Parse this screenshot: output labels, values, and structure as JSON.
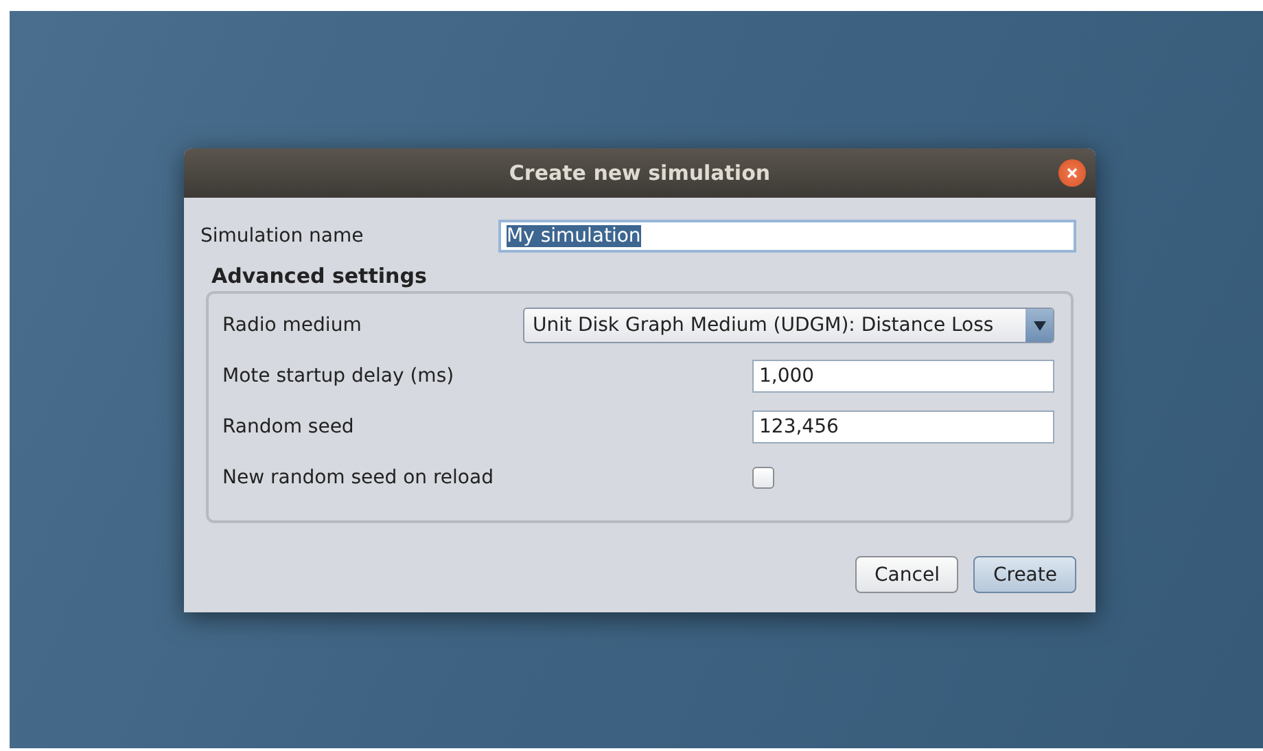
{
  "window": {
    "title": "Create new simulation"
  },
  "name_field": {
    "label": "Simulation name",
    "value": "My simulation",
    "selected": true
  },
  "advanced": {
    "title": "Advanced settings",
    "rows": [
      {
        "kind": "combo",
        "label": "Radio medium",
        "value": "Unit Disk Graph Medium (UDGM): Distance Loss"
      },
      {
        "kind": "text",
        "label": "Mote startup delay (ms)",
        "value": "1,000"
      },
      {
        "kind": "text",
        "label": "Random seed",
        "value": "123,456"
      },
      {
        "kind": "checkbox",
        "label": "New random seed on reload",
        "checked": false
      }
    ]
  },
  "buttons": [
    {
      "label": "Cancel",
      "default": false
    },
    {
      "label": "Create",
      "default": true
    }
  ]
}
